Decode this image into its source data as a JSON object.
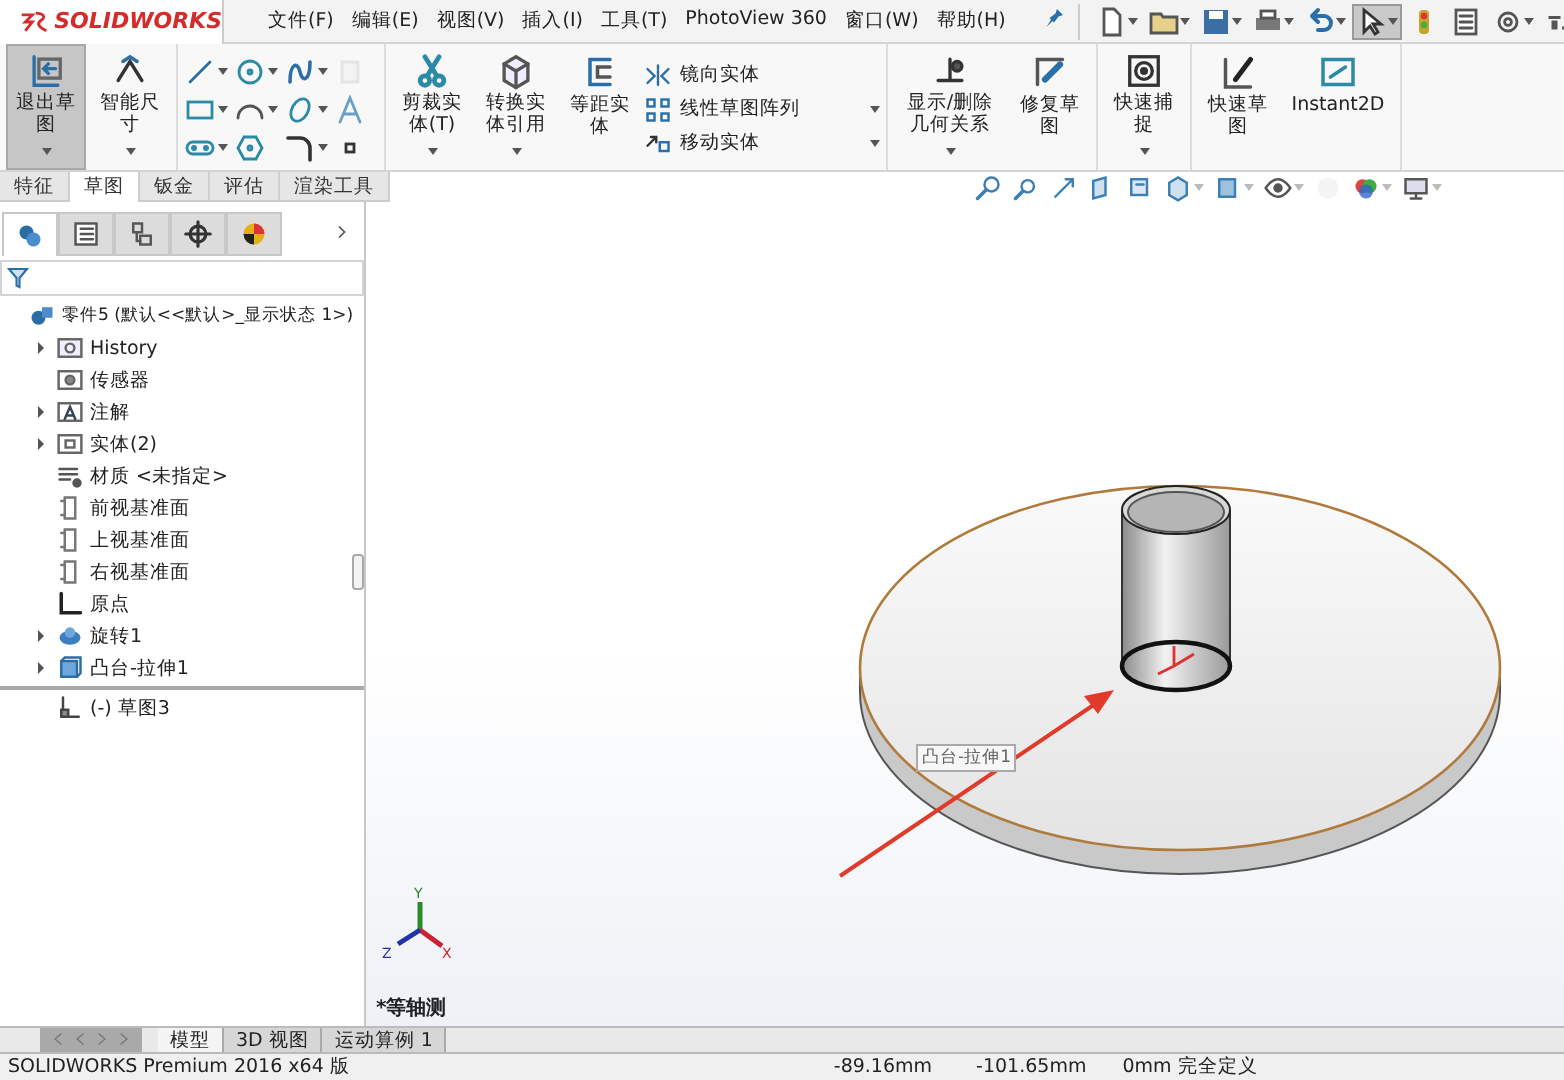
{
  "app": {
    "logo": "SOLIDWORKS"
  },
  "menu": [
    {
      "label": "文件(F)"
    },
    {
      "label": "编辑(E)"
    },
    {
      "label": "视图(V)"
    },
    {
      "label": "插入(I)"
    },
    {
      "label": "工具(T)"
    },
    {
      "label": "PhotoView 360"
    },
    {
      "label": "窗口(W)"
    },
    {
      "label": "帮助(H)"
    }
  ],
  "quick_access": [
    {
      "kind": "new",
      "dropdown": true,
      "selected": false
    },
    {
      "kind": "open",
      "dropdown": true,
      "selected": false
    },
    {
      "kind": "save",
      "dropdown": true,
      "selected": false
    },
    {
      "kind": "print",
      "dropdown": true,
      "selected": false
    },
    {
      "kind": "undo",
      "dropdown": true,
      "selected": false
    },
    {
      "kind": "select",
      "dropdown": true,
      "selected": true
    },
    {
      "kind": "rebuild",
      "dropdown": false,
      "selected": false
    },
    {
      "kind": "file_properties",
      "dropdown": false,
      "selected": false
    },
    {
      "kind": "options",
      "dropdown": true,
      "selected": false
    },
    {
      "kind": "more",
      "dropdown": false,
      "selected": false
    }
  ],
  "ribbon": [
    {
      "buttons": [
        {
          "kind": "exit_sketch",
          "label": "退出草图",
          "selected": true,
          "dropdown": true
        },
        {
          "kind": "smart_dimension",
          "label": "智能尺寸",
          "selected": false,
          "dropdown": true
        }
      ]
    },
    {
      "tools": [
        {
          "kind": "line",
          "dropdown": true,
          "disabled": false
        },
        {
          "kind": "circle",
          "dropdown": true,
          "disabled": false
        },
        {
          "kind": "spline",
          "dropdown": true,
          "disabled": false
        },
        {
          "kind": "plane",
          "dropdown": false,
          "disabled": true
        },
        {
          "kind": "rectangle",
          "dropdown": true,
          "disabled": false
        },
        {
          "kind": "arc",
          "dropdown": true,
          "disabled": false
        },
        {
          "kind": "ellipse",
          "dropdown": true,
          "disabled": false
        },
        {
          "kind": "text",
          "dropdown": false,
          "disabled": false
        },
        {
          "kind": "slot",
          "dropdown": true,
          "disabled": false
        },
        {
          "kind": "polygon",
          "dropdown": false,
          "disabled": false
        },
        {
          "kind": "fillet",
          "dropdown": true,
          "disabled": false
        },
        {
          "kind": "point",
          "dropdown": false,
          "disabled": false
        }
      ]
    },
    {
      "buttons": [
        {
          "kind": "trim",
          "label": "剪裁实体(T)",
          "selected": false,
          "dropdown": true
        },
        {
          "kind": "convert",
          "label": "转换实体引用",
          "selected": false,
          "dropdown": true
        },
        {
          "kind": "offset",
          "label": "等距实体",
          "selected": false,
          "dropdown": false
        }
      ],
      "list": [
        {
          "kind": "mirror",
          "label": "镜向实体",
          "dropdown": false
        },
        {
          "kind": "pattern",
          "label": "线性草图阵列",
          "dropdown": true
        },
        {
          "kind": "move",
          "label": "移动实体",
          "dropdown": true
        }
      ]
    },
    {
      "buttons": [
        {
          "kind": "relations",
          "label": "显示/删除几何关系",
          "selected": false,
          "dropdown": true
        },
        {
          "kind": "repair",
          "label": "修复草图",
          "selected": false,
          "dropdown": false
        }
      ]
    },
    {
      "buttons": [
        {
          "kind": "snaps",
          "label": "快速捕捉",
          "selected": false,
          "dropdown": true
        }
      ]
    },
    {
      "buttons": [
        {
          "kind": "rapid",
          "label": "快速草图",
          "selected": false,
          "dropdown": false
        },
        {
          "kind": "instant2d",
          "label": "Instant2D",
          "selected": false,
          "dropdown": false
        }
      ]
    }
  ],
  "ribbon_tabs": [
    {
      "label": "特征",
      "selected": false
    },
    {
      "label": "草图",
      "selected": true
    },
    {
      "label": "钣金",
      "selected": false
    },
    {
      "label": "评估",
      "selected": false
    },
    {
      "label": "渲染工具",
      "selected": false
    }
  ],
  "heads_up": [
    {
      "kind": "zoom_fit",
      "dropdown": false,
      "disabled": false
    },
    {
      "kind": "zoom_area",
      "dropdown": false,
      "disabled": false
    },
    {
      "kind": "previous",
      "dropdown": false,
      "disabled": false
    },
    {
      "kind": "section",
      "dropdown": false,
      "disabled": false
    },
    {
      "kind": "annotation",
      "dropdown": false,
      "disabled": false
    },
    {
      "kind": "orientation",
      "dropdown": true,
      "disabled": false
    },
    {
      "kind": "display_style",
      "dropdown": true,
      "disabled": false
    },
    {
      "kind": "hide_show",
      "dropdown": true,
      "disabled": false
    },
    {
      "kind": "appearance",
      "dropdown": false,
      "disabled": true
    },
    {
      "kind": "scene",
      "dropdown": true,
      "disabled": false
    },
    {
      "kind": "view_settings",
      "dropdown": true,
      "disabled": false
    }
  ],
  "panel_tabs": [
    {
      "kind": "feature_manager",
      "selected": true
    },
    {
      "kind": "property_manager",
      "selected": false
    },
    {
      "kind": "configuration_manager",
      "selected": false
    },
    {
      "kind": "dimxpert",
      "selected": false
    },
    {
      "kind": "display_manager",
      "selected": false
    }
  ],
  "tree": {
    "label": "零件5  (默认<<默认>_显示状态 1>)",
    "kind": "part",
    "children": [
      {
        "label": "History",
        "kind": "folder",
        "expanded": false
      },
      {
        "label": "传感器",
        "kind": "sensor"
      },
      {
        "label": "注解",
        "kind": "annotation",
        "expanded": false
      },
      {
        "label": "实体(2)",
        "kind": "solid",
        "expanded": false
      },
      {
        "label": "材质 <未指定>",
        "kind": "material"
      },
      {
        "label": "前视基准面",
        "kind": "plane"
      },
      {
        "label": "上视基准面",
        "kind": "plane"
      },
      {
        "label": "右视基准面",
        "kind": "plane"
      },
      {
        "label": "原点",
        "kind": "origin"
      },
      {
        "label": "旋转1",
        "kind": "revolve",
        "expanded": false
      },
      {
        "label": "凸台-拉伸1",
        "kind": "extrude",
        "expanded": false
      }
    ],
    "rolled_back": [
      {
        "label": "(-) 草图3",
        "kind": "sketch"
      }
    ]
  },
  "graphics": {
    "tooltip": "凸台-拉伸1",
    "axes": {
      "x": "X",
      "y": "Y",
      "z": "Z"
    },
    "view_label": "*等轴测"
  },
  "bottom_tabs": [
    {
      "label": "模型",
      "selected": true
    },
    {
      "label": "3D 视图",
      "selected": false
    },
    {
      "label": "运动算例 1",
      "selected": false
    }
  ],
  "status": {
    "product": "SOLIDWORKS Premium 2016 x64 版",
    "x": "-89.16mm",
    "y": "-101.65mm",
    "z": "0mm",
    "state": "完全定义"
  }
}
